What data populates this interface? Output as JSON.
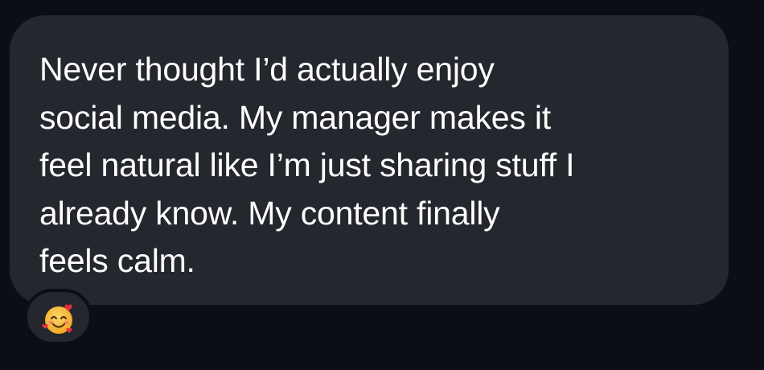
{
  "message": {
    "lines": [
      "Never thought I’d actually enjoy",
      "social media. My manager makes it",
      "feel natural like I’m just sharing stuff I",
      "already know. My content finally",
      "feels calm."
    ]
  },
  "reaction": {
    "icon": "smiling-face-with-hearts-icon"
  },
  "colors": {
    "background": "#0b0e14",
    "bubble": "#25272e",
    "text": "#ffffff",
    "emoji_face": "#f7c23a",
    "emoji_heart": "#e5303b"
  }
}
